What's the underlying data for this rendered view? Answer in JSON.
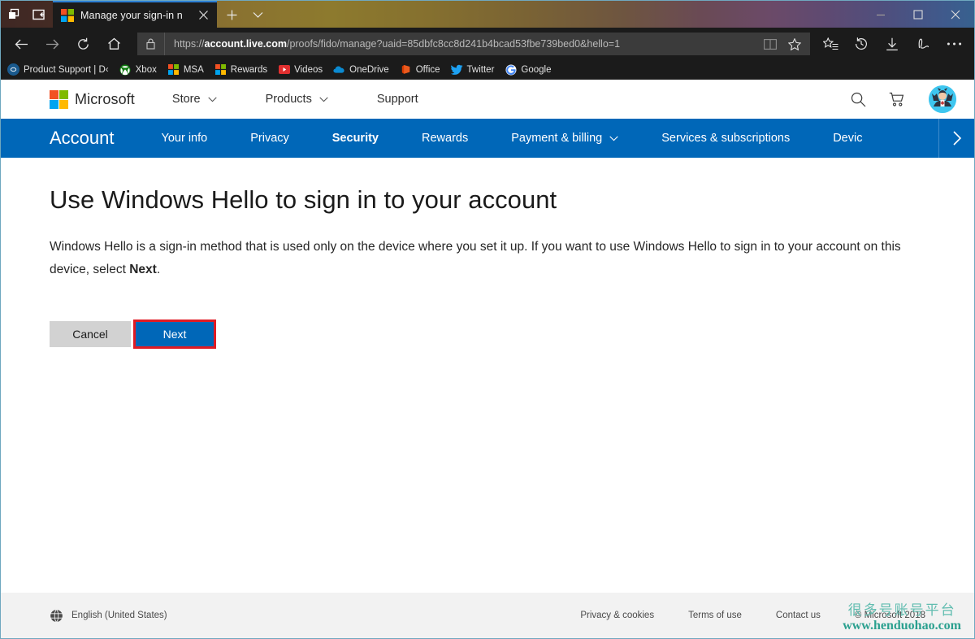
{
  "browser": {
    "titlebar": {
      "tab_preview_icon": "tab-preview-icon",
      "set_aside_tabs_icon": "set-aside-tabs-icon",
      "tab_title": "Manage your sign-in n",
      "tab_close_label": "✕",
      "new_tab_label": "+",
      "tab_menu_label": "⌄",
      "minimize_label": "—",
      "maximize_label": "□",
      "close_label": "✕"
    },
    "toolbar": {
      "back_label": "←",
      "forward_label": "→",
      "refresh_label": "↻",
      "home_label": "⌂",
      "url_prefix": "https://",
      "url_domain": "account.live.com",
      "url_path": "/proofs/fido/manage?uaid=85dbfc8cc8d241b4bcad53fbe739bed0&hello=1",
      "url_full": "https://account.live.com/proofs/fido/manage?uaid=85dbfc8cc8d241b4bcad53fbe739bed0&hello=1",
      "reading_view_label": "Reading view",
      "favorite_label": "Add to favorites",
      "favorites_hub_label": "Favorites",
      "history_label": "History",
      "downloads_label": "Downloads",
      "web_note_label": "Make a Web Note",
      "settings_label": "Settings and more"
    },
    "favorites": [
      {
        "label": "Product Support | D‹",
        "icon": "dell-icon",
        "color": "#1a5a8e"
      },
      {
        "label": "Xbox",
        "icon": "xbox-icon",
        "color": "#107c10"
      },
      {
        "label": "MSA",
        "icon": "microsoft-icon",
        "color": "#f25022"
      },
      {
        "label": "Rewards",
        "icon": "microsoft-icon",
        "color": "#f25022"
      },
      {
        "label": "Videos",
        "icon": "youtube-icon",
        "color": "#e02f2f"
      },
      {
        "label": "OneDrive",
        "icon": "onedrive-icon",
        "color": "#0b8ad1"
      },
      {
        "label": "Office",
        "icon": "office-icon",
        "color": "#d83b01"
      },
      {
        "label": "Twitter",
        "icon": "twitter-icon",
        "color": "#1da1f2"
      },
      {
        "label": "Google",
        "icon": "google-icon",
        "color": "#4285f4"
      }
    ]
  },
  "ms_header": {
    "brand": "Microsoft",
    "nav": [
      {
        "label": "Store",
        "has_caret": true
      },
      {
        "label": "Products",
        "has_caret": true
      },
      {
        "label": "Support",
        "has_caret": false
      }
    ],
    "search_icon": "search-icon",
    "cart_icon": "shopping-cart-icon",
    "avatar_icon": "user-avatar"
  },
  "account_nav": {
    "brand": "Account",
    "items": [
      {
        "label": "Your info",
        "active": false,
        "has_caret": false
      },
      {
        "label": "Privacy",
        "active": false,
        "has_caret": false
      },
      {
        "label": "Security",
        "active": true,
        "has_caret": false
      },
      {
        "label": "Rewards",
        "active": false,
        "has_caret": false
      },
      {
        "label": "Payment & billing",
        "active": false,
        "has_caret": true
      },
      {
        "label": "Services & subscriptions",
        "active": false,
        "has_caret": false
      },
      {
        "label": "Devic",
        "active": false,
        "has_caret": false,
        "clipped": true
      }
    ],
    "scroll_next_icon": "chevron-right-icon"
  },
  "main": {
    "heading": "Use Windows Hello to sign in to your account",
    "body_part1": "Windows Hello is a sign-in method that is used only on the device where you set it up. If you want to use Windows Hello to sign in to your account on this device, select ",
    "body_bold": "Next",
    "body_part2": ".",
    "cancel_label": "Cancel",
    "next_label": "Next",
    "highlight_color": "#e01b24",
    "accent_color": "#0067b8"
  },
  "footer": {
    "language_icon": "globe-icon",
    "language": "English (United States)",
    "links": [
      "Privacy & cookies",
      "Terms of use",
      "Contact us"
    ],
    "copyright": "© Microsoft 2018"
  },
  "watermark": {
    "line1": "很多号账号平台",
    "line2": "www.henduohao.com",
    "color": "#2ba08f"
  }
}
